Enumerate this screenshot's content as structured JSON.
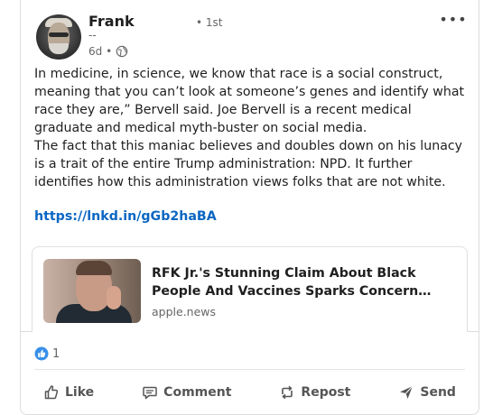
{
  "post": {
    "author_name": "Frank S",
    "degree": "• 1st",
    "headline": "--",
    "time": "6d •",
    "visibility_icon": "globe-icon",
    "more_icon": "•••",
    "paragraphs": [
      "In medicine, in science, we know that race is a social construct, meaning that you can’t look at someone’s genes and identify what race they are,” Bervell said. Joe Bervell is a recent medical graduate and medical myth-buster on social media.",
      "The fact that this maniac believes and doubles down on his lunacy is a trait of the entire Trump administration: NPD. It further identifies how this administration views folks that are not white."
    ],
    "link": "https://lnkd.in/gGb2haBA"
  },
  "preview": {
    "title": "RFK Jr.'s Stunning Claim About Black People And Vaccines Sparks Concern From Medica…",
    "source": "apple.news"
  },
  "reactions": {
    "count": "1",
    "icon": "like-badge-icon"
  },
  "actions": [
    {
      "label": "Like",
      "icon": "thumbs-up-icon"
    },
    {
      "label": "Comment",
      "icon": "comment-icon"
    },
    {
      "label": "Repost",
      "icon": "repost-icon"
    },
    {
      "label": "Send",
      "icon": "send-icon"
    }
  ],
  "colors": {
    "link": "#0a66c2",
    "like_blue": "#378fe9",
    "text": "#1f1f1f",
    "muted": "#666666"
  }
}
